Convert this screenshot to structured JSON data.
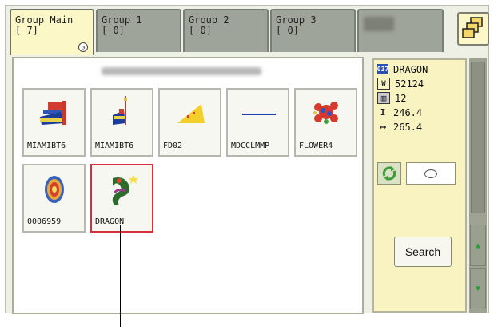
{
  "tabs": [
    {
      "name": "Group Main",
      "count": "[ 7]",
      "active": true
    },
    {
      "name": "Group 1",
      "count": "[ 0]",
      "active": false
    },
    {
      "name": "Group 2",
      "count": "[ 0]",
      "active": false
    },
    {
      "name": "Group 3",
      "count": "[ 0]",
      "active": false
    },
    {
      "name": "",
      "count": "",
      "active": false,
      "obscured": true
    }
  ],
  "designs": [
    {
      "label": "MIAMIBT6",
      "icon": "flag-design-icon",
      "selected": false
    },
    {
      "label": "MIAMIBT6",
      "icon": "flag-design-icon",
      "selected": false
    },
    {
      "label": "FD02",
      "icon": "wedge-design-icon",
      "selected": false
    },
    {
      "label": "MDCCLMMP",
      "icon": "line-design-icon",
      "selected": false
    },
    {
      "label": "FLOWER4",
      "icon": "flower-design-icon",
      "selected": false
    },
    {
      "label": "0006959",
      "icon": "medallion-design-icon",
      "selected": false
    },
    {
      "label": "DRAGON",
      "icon": "dragon-design-icon",
      "selected": true
    }
  ],
  "info": {
    "name": "DRAGON",
    "stitches": "52124",
    "colors": "12",
    "height": "246.4",
    "width": "265.4"
  },
  "search_label": "Search",
  "colors": {
    "selected_border": "#d8303a",
    "panel": "#f8f3c1",
    "active_tab": "#fbf7c6"
  }
}
